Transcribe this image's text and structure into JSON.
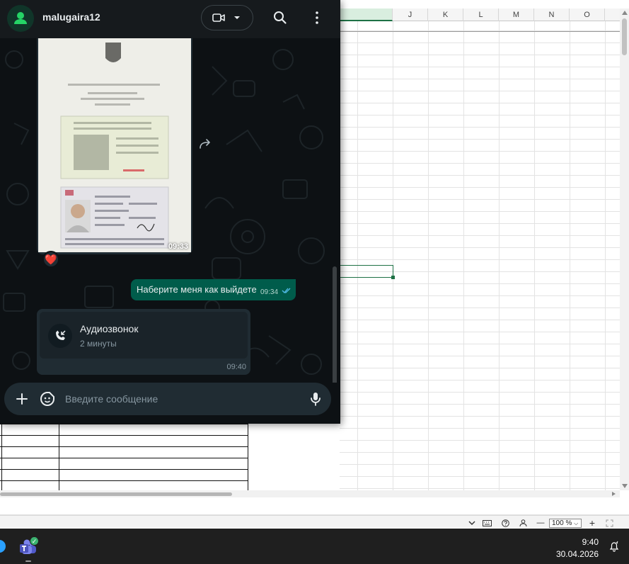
{
  "spreadsheet": {
    "columns": [
      "",
      "J",
      "K",
      "L",
      "M",
      "N",
      "O"
    ],
    "zoom": "100 %",
    "zoom_out_label": "—",
    "zoom_in_label": "+"
  },
  "taskbar": {
    "time": "9:40",
    "date": "30.04.2026"
  },
  "whatsapp": {
    "contact_name": "malugaira12",
    "photo_message": {
      "time": "09:33",
      "reaction": "❤️"
    },
    "outgoing_message": {
      "text": "Наберите меня как выйдете",
      "time": "09:34"
    },
    "call_message": {
      "title": "Аудиозвонок",
      "duration": "2 минуты",
      "time": "09:40"
    },
    "composer": {
      "placeholder": "Введите сообщение"
    }
  },
  "colors": {
    "outgoing_bubble": "#005c4b",
    "accent_green": "#25d366",
    "excel_green": "#1e7145"
  }
}
